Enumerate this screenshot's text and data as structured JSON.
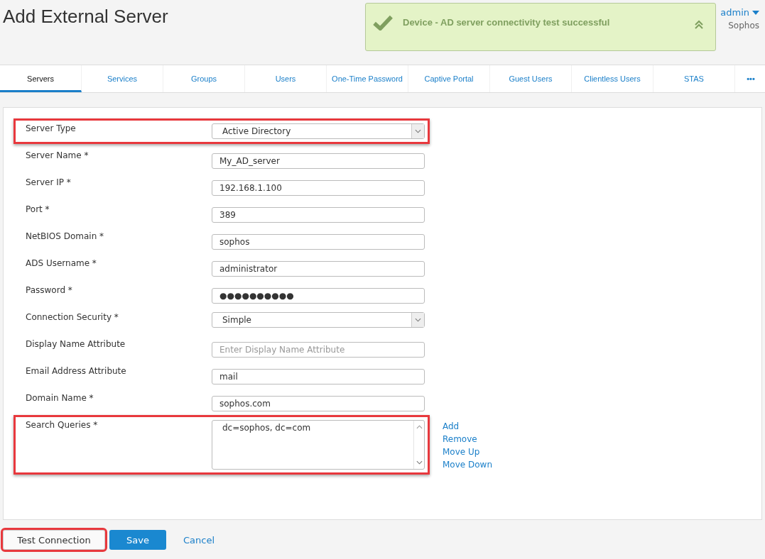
{
  "page_title": "Add External Server",
  "header_links": [
    {
      "label": "admin",
      "kind": "menu"
    }
  ],
  "header_subtitle": "Sophos",
  "toast": {
    "message": "Device - AD server connectivity test successful"
  },
  "tabs": [
    {
      "label": "Servers",
      "selected": true
    },
    {
      "label": "Services",
      "selected": false
    },
    {
      "label": "Groups",
      "selected": false
    },
    {
      "label": "Users",
      "selected": false
    },
    {
      "label": "One-Time Password",
      "selected": false
    },
    {
      "label": "Captive Portal",
      "selected": false
    },
    {
      "label": "Guest Users",
      "selected": false
    },
    {
      "label": "Clientless Users",
      "selected": false
    },
    {
      "label": "STAS",
      "selected": false
    },
    {
      "label": "•••",
      "selected": false
    }
  ],
  "fields": [
    {
      "label": "Server Type",
      "kind": "select",
      "value": "Active Directory",
      "highlighted": true
    },
    {
      "label": "Server Name *",
      "kind": "text",
      "value": "My_AD_server",
      "highlighted": false
    },
    {
      "label": "Server IP *",
      "kind": "text",
      "value": "192.168.1.100",
      "highlighted": false
    },
    {
      "label": "Port *",
      "kind": "text",
      "value": "389",
      "highlighted": false
    },
    {
      "label": "NetBIOS Domain *",
      "kind": "text",
      "value": "sophos",
      "highlighted": false
    },
    {
      "label": "ADS Username *",
      "kind": "text",
      "value": "administrator",
      "highlighted": false
    },
    {
      "label": "Password *",
      "kind": "password",
      "value": "●●●●●●●●●●",
      "highlighted": false
    },
    {
      "label": "Connection Security *",
      "kind": "select",
      "value": "Simple",
      "highlighted": false
    },
    {
      "label": "Display Name Attribute",
      "kind": "text",
      "placeholder": "Enter Display Name Attribute",
      "highlighted": false
    },
    {
      "label": "Email Address Attribute",
      "kind": "text",
      "value": "mail",
      "highlighted": false
    },
    {
      "label": "Domain Name *",
      "kind": "text",
      "value": "sophos.com",
      "highlighted": false
    },
    {
      "label": "Search Queries *",
      "kind": "list",
      "value": "dc=sophos, dc=com",
      "highlighted": true,
      "actions": [
        "Add",
        "Remove",
        "Move Up",
        "Move Down"
      ]
    }
  ],
  "buttons": [
    {
      "label": "Test Connection",
      "kind": "secondary",
      "highlighted": true
    },
    {
      "label": "Save",
      "kind": "primary",
      "highlighted": false
    },
    {
      "label": "Cancel",
      "kind": "link",
      "highlighted": false
    }
  ]
}
